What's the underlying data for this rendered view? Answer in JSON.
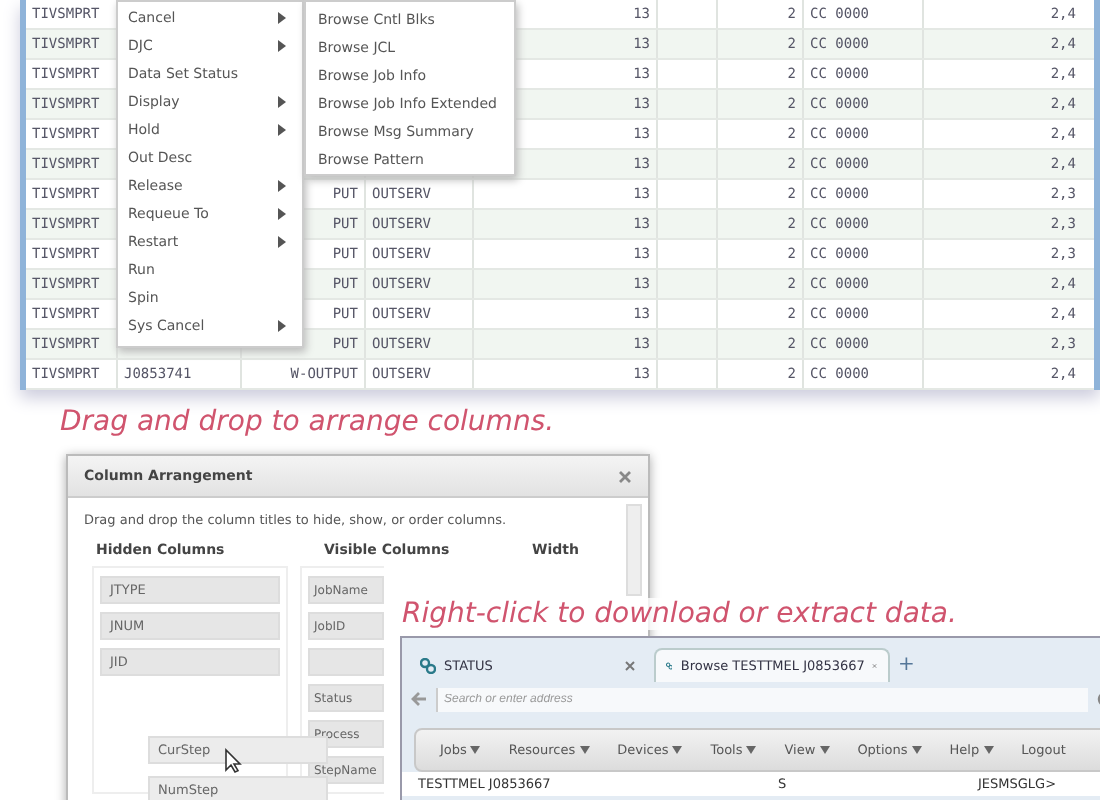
{
  "job_table": {
    "rows": [
      {
        "name": "TIVSMPRT",
        "steps": "13",
        "rc_num": "2",
        "rc": "CC 0000",
        "col_8": "2,4"
      },
      {
        "name": "TIVSMPRT",
        "steps": "13",
        "rc_num": "2",
        "rc": "CC 0000",
        "col_8": "2,4"
      },
      {
        "name": "TIVSMPRT",
        "steps": "13",
        "rc_num": "2",
        "rc": "CC 0000",
        "col_8": "2,4"
      },
      {
        "name": "TIVSMPRT",
        "steps": "13",
        "rc_num": "2",
        "rc": "CC 0000",
        "col_8": "2,4"
      },
      {
        "name": "TIVSMPRT",
        "steps": "13",
        "rc_num": "2",
        "rc": "CC 0000",
        "col_8": "2,4"
      },
      {
        "name": "TIVSMPRT",
        "steps": "13",
        "rc_num": "2",
        "rc": "CC 0000",
        "col_8": "2,4"
      },
      {
        "name": "TIVSMPRT",
        "type": "PUT",
        "class": "OUTSERV",
        "steps": "13",
        "rc_num": "2",
        "rc": "CC 0000",
        "col_8": "2,3"
      },
      {
        "name": "TIVSMPRT",
        "type": "PUT",
        "class": "OUTSERV",
        "steps": "13",
        "rc_num": "2",
        "rc": "CC 0000",
        "col_8": "2,3"
      },
      {
        "name": "TIVSMPRT",
        "type": "PUT",
        "class": "OUTSERV",
        "steps": "13",
        "rc_num": "2",
        "rc": "CC 0000",
        "col_8": "2,3"
      },
      {
        "name": "TIVSMPRT",
        "type": "PUT",
        "class": "OUTSERV",
        "steps": "13",
        "rc_num": "2",
        "rc": "CC 0000",
        "col_8": "2,4"
      },
      {
        "name": "TIVSMPRT",
        "type": "PUT",
        "class": "OUTSERV",
        "steps": "13",
        "rc_num": "2",
        "rc": "CC 0000",
        "col_8": "2,4"
      },
      {
        "name": "TIVSMPRT",
        "type": "PUT",
        "class": "OUTSERV",
        "steps": "13",
        "rc_num": "2",
        "rc": "CC 0000",
        "col_8": "2,3"
      },
      {
        "name": "TIVSMPRT",
        "job_id": "J0853741",
        "type": "W-OUTPUT",
        "class": "OUTSERV",
        "steps": "13",
        "rc_num": "2",
        "rc": "CC 0000",
        "col_8": "2,4"
      }
    ]
  },
  "context_menu": {
    "items": [
      {
        "label": "Cancel",
        "submenu": true
      },
      {
        "label": "DJC",
        "submenu": true
      },
      {
        "label": "Data Set Status",
        "submenu": false
      },
      {
        "label": "Display",
        "submenu": true
      },
      {
        "label": "Hold",
        "submenu": true
      },
      {
        "label": "Out Desc",
        "submenu": false
      },
      {
        "label": "Release",
        "submenu": true
      },
      {
        "label": "Requeue To",
        "submenu": true
      },
      {
        "label": "Restart",
        "submenu": true
      },
      {
        "label": "Run",
        "submenu": false
      },
      {
        "label": "Spin",
        "submenu": false
      },
      {
        "label": "Sys Cancel",
        "submenu": true
      }
    ]
  },
  "submenu": {
    "items": [
      "Browse Cntl Blks",
      "Browse JCL",
      "Browse Job Info",
      "Browse Job Info Extended",
      "Browse Msg Summary",
      "Browse Pattern"
    ]
  },
  "captions": [
    "Drag and drop to arrange columns.",
    "Right-click to download or extract data."
  ],
  "column_dialog": {
    "title": "Column Arrangement",
    "instructions": "Drag and drop the column titles to hide, show, or order columns.",
    "hidden_header": "Hidden Columns",
    "visible_header": "Visible Columns",
    "width_header": "Width",
    "hidden_columns": [
      "JTYPE",
      "JNUM",
      "JID"
    ],
    "visible_columns": [
      {
        "kind": "item",
        "label": "JobName"
      },
      {
        "kind": "item",
        "label": "JobID"
      },
      {
        "kind": "blank"
      },
      {
        "kind": "item",
        "label": "Status"
      },
      {
        "kind": "item",
        "label": "Process"
      },
      {
        "kind": "item",
        "label": "StepName"
      }
    ],
    "dragged_items": [
      "CurStep",
      "NumStep"
    ]
  },
  "browser": {
    "tabs": [
      {
        "label": "STATUS",
        "selected": false
      },
      {
        "label": "Browse TESTTMEL J0853667",
        "selected": true
      }
    ],
    "new_tab": "+",
    "address_placeholder": "Search or enter address",
    "menu": [
      {
        "label": "Jobs",
        "dropdown": true
      },
      {
        "label": "Resources",
        "dropdown": true
      },
      {
        "label": "Devices",
        "dropdown": true
      },
      {
        "label": "Tools",
        "dropdown": true
      },
      {
        "label": "View",
        "dropdown": true
      },
      {
        "label": "Options",
        "dropdown": true
      },
      {
        "label": "Help",
        "dropdown": true
      },
      {
        "label": "Logout",
        "dropdown": false
      }
    ],
    "row": [
      "TESTTMEL J0853667",
      "S",
      "JESMSGLG>"
    ]
  }
}
